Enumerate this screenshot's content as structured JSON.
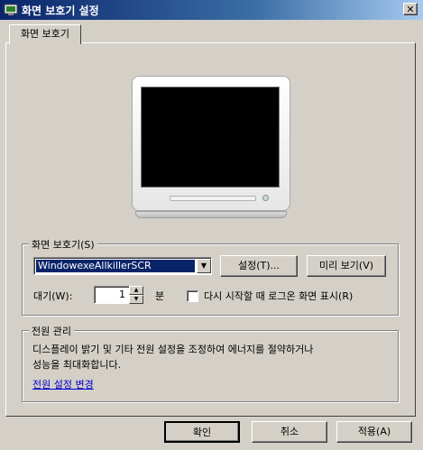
{
  "window": {
    "title": "화면 보호기 설정",
    "close_glyph": "✕"
  },
  "tab": {
    "label": "화면 보호기"
  },
  "screensaver": {
    "group_label": "화면 보호기(S)",
    "selected": "WindowexeAllkillerSCR",
    "settings_button": "설정(T)...",
    "preview_button": "미리 보기(V)",
    "wait_label": "대기(W):",
    "wait_value": "1",
    "wait_unit": "분",
    "resume_checkbox_label": "다시 시작할 때 로그온 화면 표시(R)",
    "resume_checked": false
  },
  "power": {
    "group_label": "전원 관리",
    "description_line1": "디스플레이 밝기 및 기타 전원 설정을 조정하여 에너지를 절약하거나",
    "description_line2": "성능을 최대화합니다.",
    "link": "전원 설정 변경"
  },
  "footer": {
    "ok": "확인",
    "cancel": "취소",
    "apply": "적용(A)"
  }
}
